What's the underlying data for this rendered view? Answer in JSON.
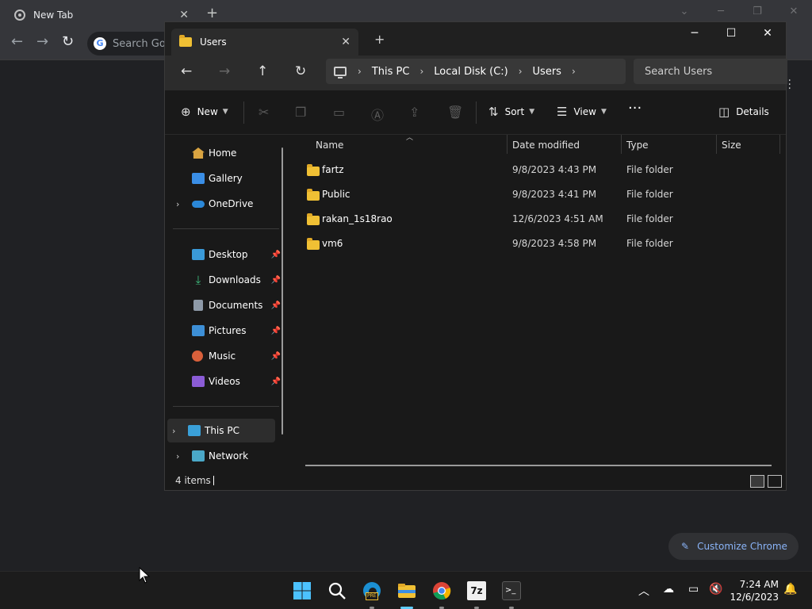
{
  "chrome": {
    "tab_title": "New Tab",
    "omnibox_placeholder": "Search Goo",
    "customize_label": "Customize Chrome"
  },
  "explorer": {
    "tab_title": "Users",
    "breadcrumbs": [
      "This PC",
      "Local Disk (C:)",
      "Users"
    ],
    "search_placeholder": "Search Users",
    "commands": {
      "new": "New",
      "sort": "Sort",
      "view": "View",
      "details": "Details"
    },
    "nav": {
      "home": "Home",
      "gallery": "Gallery",
      "onedrive": "OneDrive",
      "desktop": "Desktop",
      "downloads": "Downloads",
      "documents": "Documents",
      "pictures": "Pictures",
      "music": "Music",
      "videos": "Videos",
      "this_pc": "This PC",
      "network": "Network"
    },
    "columns": {
      "name": "Name",
      "date": "Date modified",
      "type": "Type",
      "size": "Size"
    },
    "files": [
      {
        "name": "fartz",
        "date": "9/8/2023 4:43 PM",
        "type": "File folder",
        "size": ""
      },
      {
        "name": "Public",
        "date": "9/8/2023 4:41 PM",
        "type": "File folder",
        "size": ""
      },
      {
        "name": "rakan_1s18rao",
        "date": "12/6/2023 4:51 AM",
        "type": "File folder",
        "size": ""
      },
      {
        "name": "vm6",
        "date": "9/8/2023 4:58 PM",
        "type": "File folder",
        "size": ""
      }
    ],
    "status": "4 items"
  },
  "taskbar": {
    "time": "7:24 AM",
    "date": "12/6/2023",
    "edge_badge": "PRE",
    "sevenzip_label": "7z"
  },
  "colors": {
    "accent": "#60cdff",
    "folder": "#f0c034",
    "chrome_link": "#8ab4f8"
  }
}
